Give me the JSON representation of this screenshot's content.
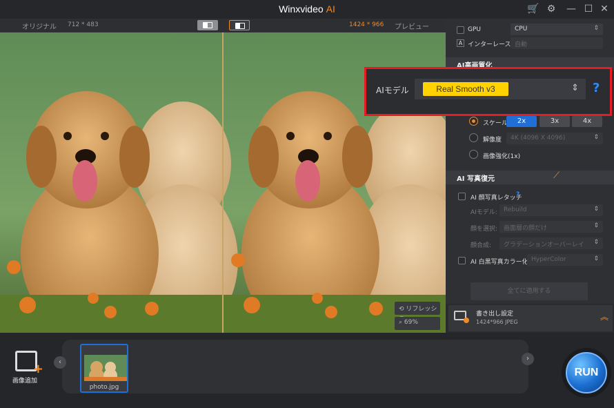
{
  "app": {
    "title": "Winxvideo",
    "title_ai": "AI"
  },
  "window_icons": {
    "cart": "cart-icon",
    "settings": "gear-icon",
    "minimize": "minimize-icon",
    "maximize": "maximize-icon",
    "close": "close-icon"
  },
  "viewer": {
    "left_label": "オリジナル",
    "left_dims": "712 * 483",
    "right_dims": "1424 * 966",
    "right_label": "プレビュー",
    "refresh_label": "リフレッシュ",
    "zoom_label": "69%"
  },
  "panel": {
    "gpu_label": "GPU",
    "gpu_value": "CPU",
    "deinterlace_label": "インターレース解除",
    "deinterlace_value": "自動",
    "section_upscale": "AI高画質化",
    "model_label": "AIモデル",
    "model_value": "Real Smooth v3",
    "scale_label": "スケール",
    "scale_options": [
      "2x",
      "3x",
      "4x"
    ],
    "resolution_label": "解像度",
    "resolution_value": "4K (4096 X 4096)",
    "enhance_label": "画像強化(1x)",
    "section_restore": "AI 写真復元",
    "face_label": "AI 顔写真レタッチ",
    "restore_model_label": "AIモデル:",
    "restore_model_value": "Rebuild",
    "face_select_label": "顔を選択:",
    "face_select_value": "画面層の顔だけ",
    "blend_label": "顔合成:",
    "blend_value": "グラデーションオーバーレイ",
    "colorize_label": "AI 白黒写真カラー化:",
    "colorize_value": "HyperColor",
    "apply_all": "全てに適用する"
  },
  "export": {
    "title": "書き出し設定",
    "info": "1424*966  JPEG"
  },
  "bottom": {
    "add_label": "画像追加",
    "thumb_name": "photo.jpg",
    "run_label": "RUN"
  },
  "colors": {
    "accent": "#f08a24",
    "blue": "#1f6fd6",
    "highlight": "#e51c23",
    "model_bg": "#ffd200"
  }
}
